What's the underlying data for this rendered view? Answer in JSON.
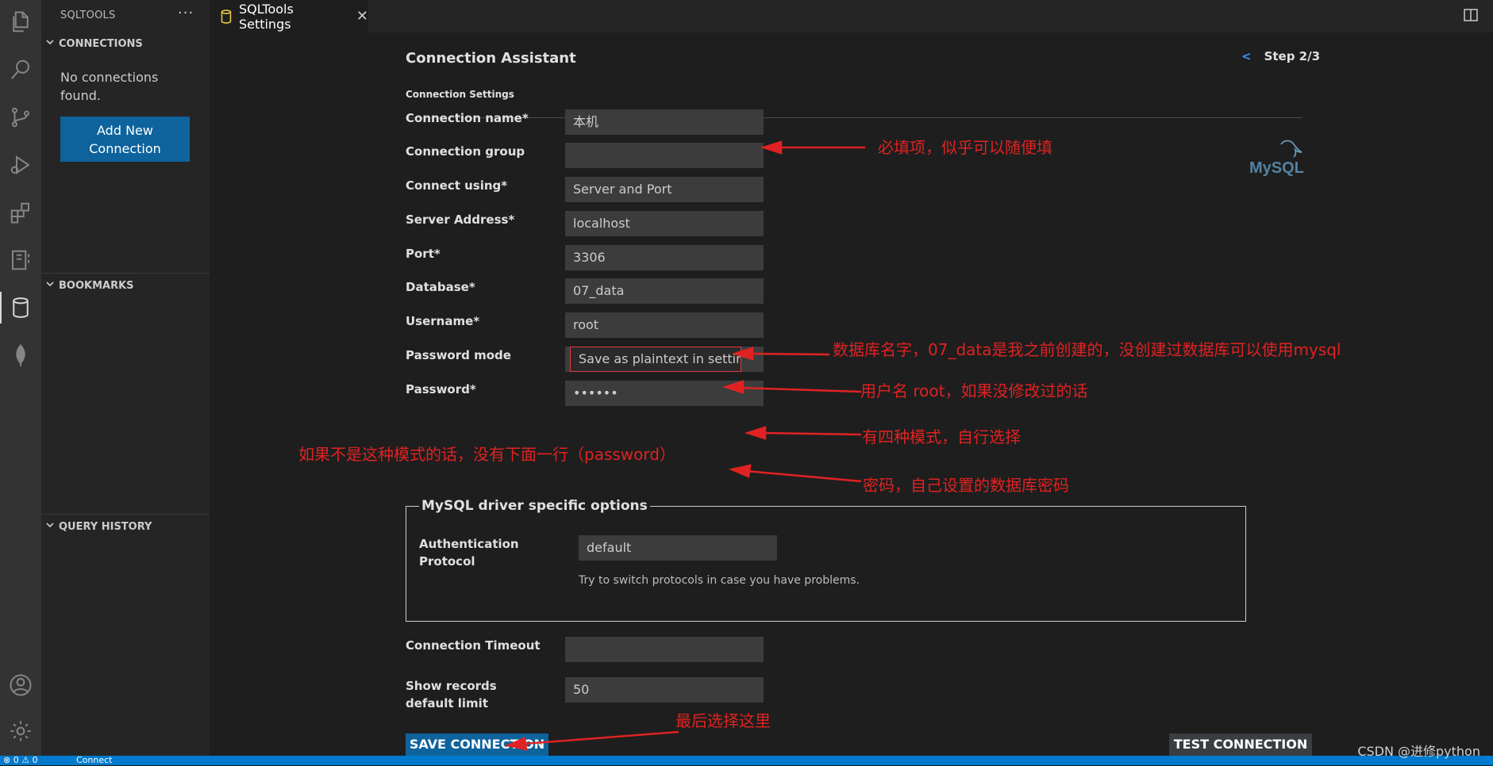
{
  "activity_bar": {
    "icons": [
      "explorer-icon",
      "search-icon",
      "source-control-icon",
      "run-debug-icon",
      "extensions-icon",
      "notebook-icon",
      "database-icon",
      "mongodb-leaf-icon",
      "account-icon",
      "gear-icon"
    ]
  },
  "sidebar": {
    "title": "SQLTOOLS",
    "more": "···",
    "sections": {
      "connections": "CONNECTIONS",
      "bookmarks": "BOOKMARKS",
      "query_history": "QUERY HISTORY"
    },
    "no_connections": "No connections found.",
    "add_button": "Add New Connection"
  },
  "tab": {
    "label": "SQLTools Settings",
    "close": "✕"
  },
  "form": {
    "title": "Connection Assistant",
    "subtitle": "Connection Settings",
    "step_back": "<",
    "step": "Step 2/3",
    "fields": [
      {
        "label": "Connection name*",
        "value": "本机"
      },
      {
        "label": "Connection group",
        "value": ""
      },
      {
        "label": "Connect using*",
        "value": "Server and Port"
      },
      {
        "label": "Server Address*",
        "value": "localhost"
      },
      {
        "label": "Port*",
        "value": "3306"
      },
      {
        "label": "Database*",
        "value": "07_data"
      },
      {
        "label": "Username*",
        "value": "root"
      },
      {
        "label": "Password mode",
        "value": "Save as plaintext in settings"
      },
      {
        "label": "Password*",
        "value": "••••••"
      }
    ],
    "driver_options": {
      "legend": "MySQL driver specific options",
      "auth_label": "Authentication Protocol",
      "auth_value": "default",
      "hint": "Try to switch protocols in case you have problems."
    },
    "timeout": {
      "label": "Connection Timeout",
      "value": ""
    },
    "records_limit": {
      "label": "Show records default limit",
      "value": "50"
    },
    "save_button": "SAVE CONNECTION",
    "test_button": "TEST CONNECTION",
    "logo_text": "MySQL"
  },
  "annotations": {
    "required": "必填项，似乎可以随便填",
    "database": "数据库名字，07_data是我之前创建的，没创建过数据库可以使用mysql",
    "username": "用户名 root，如果没修改过的话",
    "password_mode": "有四种模式，自行选择",
    "password_mode_note": "如果不是这种模式的话，没有下面一行（password）",
    "password": "密码，自己设置的数据库密码",
    "save": "最后选择这里"
  },
  "statusbar": {
    "problems": "⊗ 0 ⚠ 0",
    "connect": "Connect"
  },
  "watermark": "CSDN @进修python",
  "colors": {
    "accent_blue": "#0e639c",
    "annotation_red": "#e02222",
    "statusbar": "#007acc"
  }
}
